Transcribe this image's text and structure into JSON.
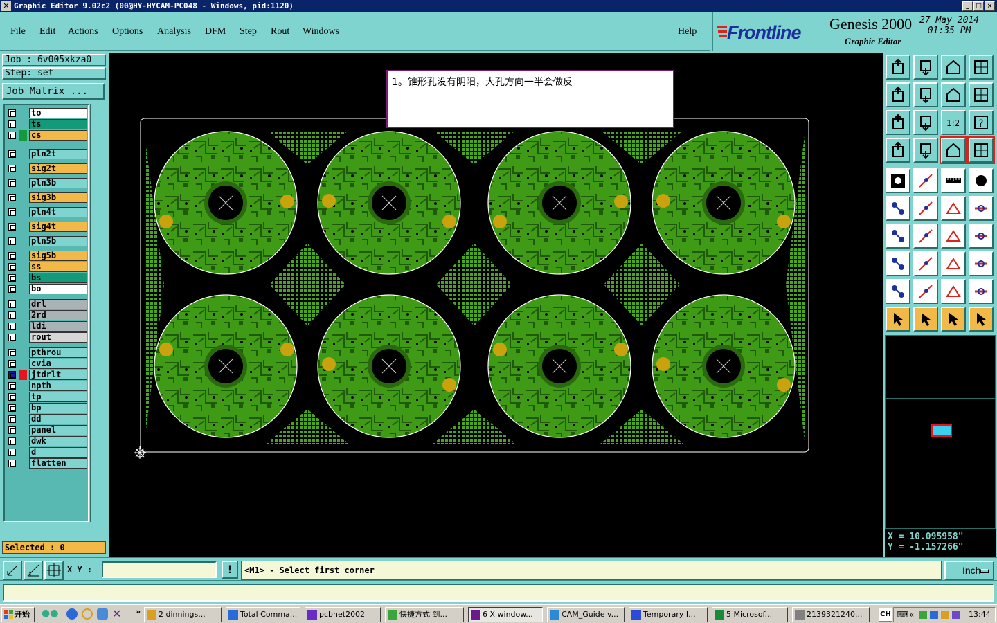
{
  "window": {
    "title": "Graphic Editor 9.02c2  (00@HY-HYCAM-PC048 - Windows, pid:1120)"
  },
  "menu": [
    "File",
    "Edit",
    "Actions",
    "Options",
    "Analysis",
    "DFM",
    "Step",
    "Rout",
    "Windows"
  ],
  "help_label": "Help",
  "brand": {
    "logo": "Frontline",
    "product": "Genesis 2000",
    "subtitle": "Graphic Editor",
    "date": "27 May 2014",
    "time": "01:35 PM"
  },
  "job": {
    "job": "Job : 6v005xkza0",
    "step": "Step: set",
    "matrix_button": "Job Matrix ..."
  },
  "layers": [
    {
      "name": "to",
      "color": "#ffffff",
      "mark": ""
    },
    {
      "name": "ts",
      "color": "#139a78",
      "mark": ""
    },
    {
      "name": "cs",
      "color": "#f2b848",
      "mark": "#139a3c"
    },
    {
      "name": "pln2t",
      "color": "#7fd4cf",
      "mark": ""
    },
    {
      "name": "sig2t",
      "color": "#f2b848",
      "mark": ""
    },
    {
      "name": "pln3b",
      "color": "#7fd4cf",
      "mark": ""
    },
    {
      "name": "sig3b",
      "color": "#f2b848",
      "mark": ""
    },
    {
      "name": "pln4t",
      "color": "#7fd4cf",
      "mark": ""
    },
    {
      "name": "sig4t",
      "color": "#f2b848",
      "mark": ""
    },
    {
      "name": "pln5b",
      "color": "#7fd4cf",
      "mark": ""
    },
    {
      "name": "sig5b",
      "color": "#f2b848",
      "mark": ""
    },
    {
      "name": "ss",
      "color": "#f2b848",
      "mark": ""
    },
    {
      "name": "bs",
      "color": "#139a78",
      "mark": ""
    },
    {
      "name": "bo",
      "color": "#ffffff",
      "mark": ""
    },
    {
      "name": "drl",
      "color": "#a9b3b6",
      "mark": ""
    },
    {
      "name": "2rd",
      "color": "#a9b3b6",
      "mark": ""
    },
    {
      "name": "ldi",
      "color": "#a9b3b6",
      "mark": ""
    },
    {
      "name": "rout",
      "color": "#d6d6d6",
      "mark": ""
    },
    {
      "name": "pthrou",
      "color": "#7fd4cf",
      "mark": ""
    },
    {
      "name": "cvia",
      "color": "#7fd4cf",
      "mark": ""
    },
    {
      "name": "jtdrlt",
      "color": "#7fd4cf",
      "mark": "#e8131f"
    },
    {
      "name": "npth",
      "color": "#7fd4cf",
      "mark": ""
    },
    {
      "name": "tp",
      "color": "#7fd4cf",
      "mark": ""
    },
    {
      "name": "bp",
      "color": "#7fd4cf",
      "mark": ""
    },
    {
      "name": "dd",
      "color": "#7fd4cf",
      "mark": ""
    },
    {
      "name": "panel",
      "color": "#7fd4cf",
      "mark": ""
    },
    {
      "name": "dwk",
      "color": "#7fd4cf",
      "mark": ""
    },
    {
      "name": "d",
      "color": "#7fd4cf",
      "mark": ""
    },
    {
      "name": "flatten",
      "color": "#7fd4cf",
      "mark": ""
    }
  ],
  "selected": "Selected : 0",
  "note": "1。锥形孔没有阴阳，大孔方向一半会做反",
  "coords": {
    "x": "X  =  10.095958\"",
    "y": "Y  =  -1.157266\""
  },
  "command": {
    "xy_label": "X Y :",
    "xy_value": "",
    "prompt": "<M1> - Select first corner",
    "unit": "Inch"
  },
  "colors": {
    "board": "#3f9a16",
    "copper": "#2a6a0e",
    "pad": "#c9a20e",
    "accent": "#7fd4cf"
  },
  "taskbar": {
    "start": "开始",
    "tasks": [
      "2 dinnings...",
      "Total Comma...",
      "pcbnet2002",
      "快捷方式 到...",
      "6 X window...",
      "CAM_Guide v...",
      "Temporary I...",
      "5 Microsof...",
      "2139321240..."
    ],
    "lang": "CH",
    "clock": "13:44"
  }
}
